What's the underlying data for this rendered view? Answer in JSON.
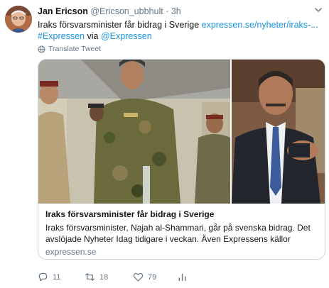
{
  "tweet": {
    "author_name": "Jan Ericson",
    "author_handle": "@Ericson_ubbhult",
    "separator": "·",
    "time": "3h",
    "text_plain": "Iraks försvarsminister får bidrag i Sverige ",
    "text_link": "expressen.se/nyheter/iraks-...",
    "hashtag": "#Expressen",
    "via_word": " via ",
    "mention": "@Expressen",
    "translate_label": "Translate Tweet"
  },
  "card": {
    "title": "Iraks försvarsminister får bidrag i Sverige",
    "description": "Iraks försvarsminister, Najah al-Shammari, går på svenska bidrag. Det avslöjade Nyheter Idag tidigare i veckan. Även Expressens källor bekräftar...",
    "domain": "expressen.se"
  },
  "actions": {
    "replies": "11",
    "retweets": "18",
    "likes": "79"
  },
  "colors": {
    "link": "#1b95e0",
    "muted": "#657786",
    "border": "#ccd6dd"
  },
  "icons": [
    "chevron-down-icon",
    "globe-icon",
    "reply-icon",
    "retweet-icon",
    "like-icon",
    "analytics-icon"
  ]
}
